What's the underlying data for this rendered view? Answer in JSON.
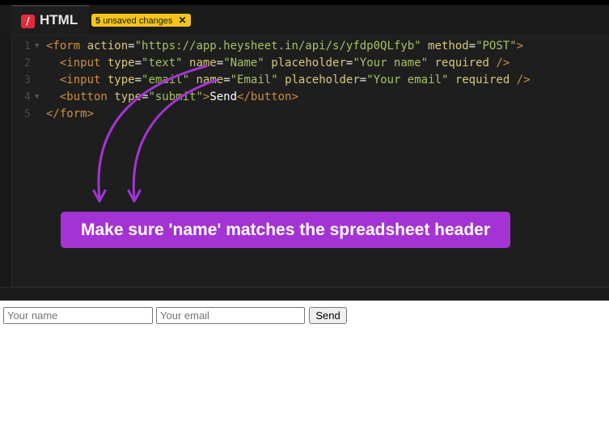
{
  "tab": {
    "icon": "html-file-icon",
    "title": "HTML"
  },
  "unsaved_badge": {
    "count": "5",
    "text": "unsaved changes",
    "close": "✕"
  },
  "code_lines": [
    {
      "num": "1",
      "fold": true,
      "tokens": [
        {
          "c": "tag",
          "t": "<form "
        },
        {
          "c": "attr",
          "t": "action"
        },
        {
          "c": "eq",
          "t": "="
        },
        {
          "c": "str",
          "t": "\"https://app.heysheet.in/api/s/yfdp0QLfyb\""
        },
        {
          "c": "attr",
          "t": " method"
        },
        {
          "c": "eq",
          "t": "="
        },
        {
          "c": "str",
          "t": "\"POST\""
        },
        {
          "c": "tag",
          "t": ">"
        }
      ]
    },
    {
      "num": "2",
      "fold": false,
      "tokens": [
        {
          "c": "tag",
          "t": "  <input "
        },
        {
          "c": "attr",
          "t": "type"
        },
        {
          "c": "eq",
          "t": "="
        },
        {
          "c": "str",
          "t": "\"text\""
        },
        {
          "c": "attr",
          "t": " name"
        },
        {
          "c": "eq",
          "t": "="
        },
        {
          "c": "str",
          "t": "\"Name\""
        },
        {
          "c": "attr",
          "t": " placeholder"
        },
        {
          "c": "eq",
          "t": "="
        },
        {
          "c": "str",
          "t": "\"Your name\""
        },
        {
          "c": "attr",
          "t": " required"
        },
        {
          "c": "tag",
          "t": " />"
        }
      ]
    },
    {
      "num": "3",
      "fold": false,
      "tokens": [
        {
          "c": "tag",
          "t": "  <input "
        },
        {
          "c": "attr",
          "t": "type"
        },
        {
          "c": "eq",
          "t": "="
        },
        {
          "c": "str",
          "t": "\"email\""
        },
        {
          "c": "attr",
          "t": " name"
        },
        {
          "c": "eq",
          "t": "="
        },
        {
          "c": "str",
          "t": "\"Email\""
        },
        {
          "c": "attr",
          "t": " placeholder"
        },
        {
          "c": "eq",
          "t": "="
        },
        {
          "c": "str",
          "t": "\"Your email\""
        },
        {
          "c": "attr",
          "t": " required"
        },
        {
          "c": "tag",
          "t": " />"
        }
      ]
    },
    {
      "num": "4",
      "fold": true,
      "tokens": [
        {
          "c": "tag",
          "t": "  <button "
        },
        {
          "c": "attr",
          "t": "type"
        },
        {
          "c": "eq",
          "t": "="
        },
        {
          "c": "str",
          "t": "\"submit\""
        },
        {
          "c": "tag",
          "t": ">"
        },
        {
          "c": "plain",
          "t": "Send"
        },
        {
          "c": "tag",
          "t": "</button>"
        }
      ]
    },
    {
      "num": "5",
      "fold": false,
      "tokens": [
        {
          "c": "tag",
          "t": "</form>"
        }
      ]
    }
  ],
  "callout": {
    "text": "Make sure 'name' matches the spreadsheet header",
    "color": "#a334d3"
  },
  "preview": {
    "name_placeholder": "Your name",
    "email_placeholder": "Your email",
    "send_label": "Send"
  }
}
